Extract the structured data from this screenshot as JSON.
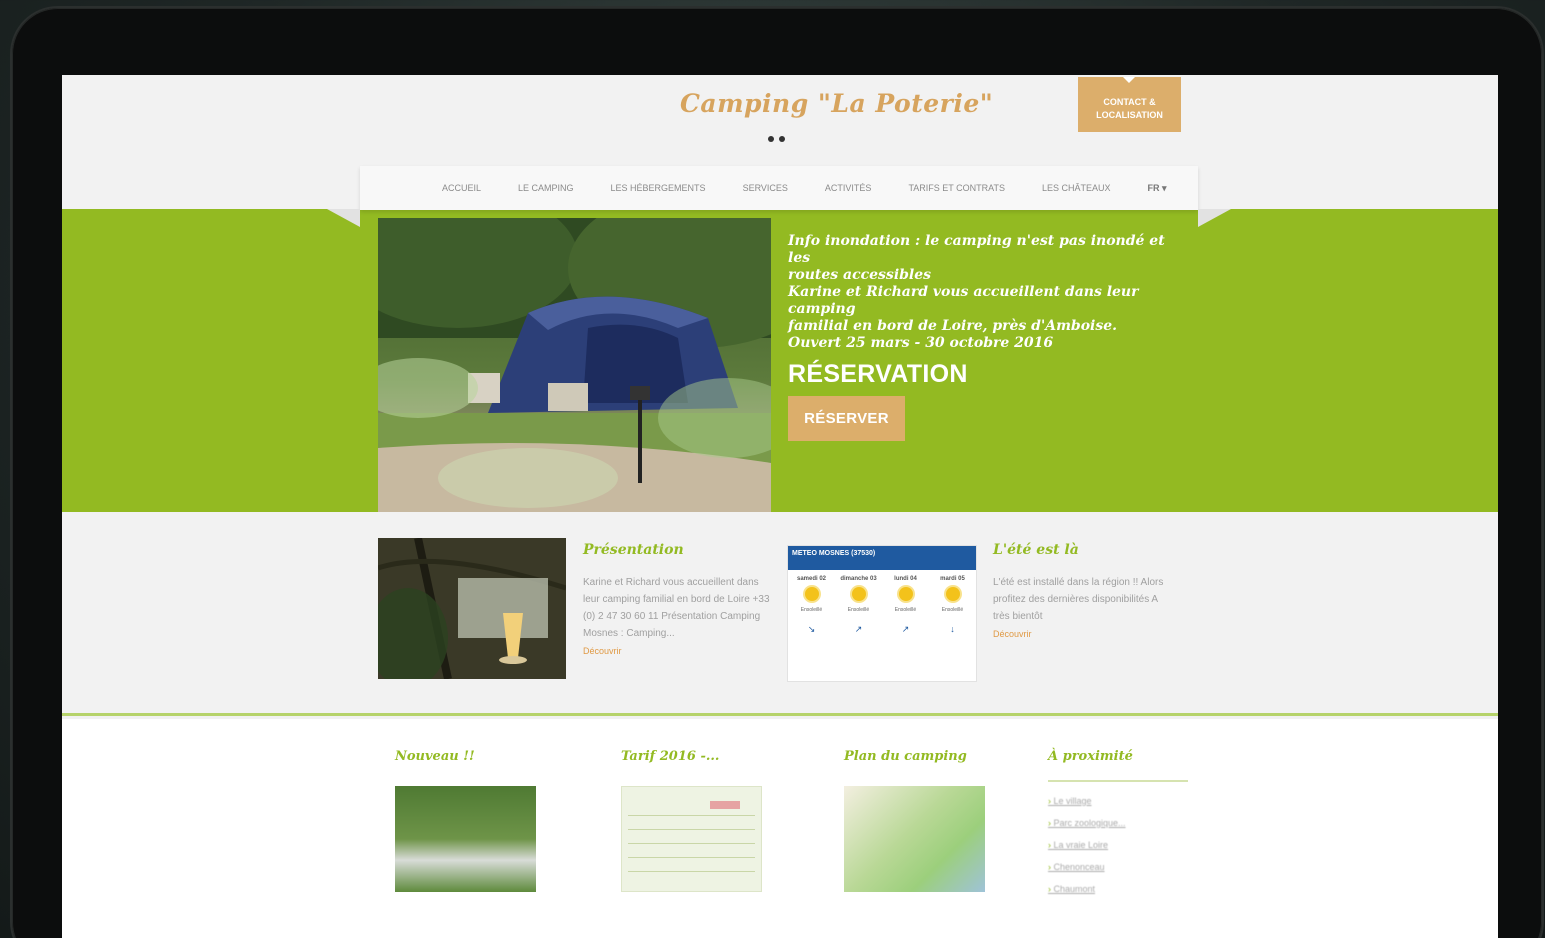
{
  "site": {
    "logo": "Camping \"La Poterie\"",
    "contact_button": "CONTACT & LOCALISATION"
  },
  "nav": {
    "items": [
      "ACCUEIL",
      "LE CAMPING",
      "LES HÉBERGEMENTS",
      "SERVICES",
      "ACTIVITÉS",
      "TARIFS ET CONTRATS",
      "LES CHÂTEAUX"
    ],
    "lang": "FR ▾"
  },
  "hero": {
    "info_lines": [
      "Info inondation : le camping n'est pas inondé et les",
      "routes accessibles",
      "Karine et Richard vous accueillent dans leur camping",
      "familial en bord de Loire, près d'Amboise.",
      "Ouvert 25 mars - 30 octobre 2016"
    ],
    "title": "RÉSERVATION",
    "button": "RÉSERVER"
  },
  "presentation": {
    "title": "Présentation",
    "text": "Karine et Richard vous accueillent dans leur camping familial en bord de Loire +33 (0) 2 47 30 60 11 Présentation Camping Mosnes : Camping...",
    "link": "Découvrir"
  },
  "weather": {
    "header": "METEO MOSNES (37530)",
    "days": [
      {
        "day": "samedi 02",
        "cond": "Ensoleillé"
      },
      {
        "day": "dimanche 03",
        "cond": "Ensoleillé"
      },
      {
        "day": "lundi 04",
        "cond": "Ensoleillé"
      },
      {
        "day": "mardi 05",
        "cond": "Ensoleillé"
      }
    ]
  },
  "ete": {
    "title": "L'été est là",
    "text": "L'été est installé dans la région !! Alors profitez des dernières disponibilités A très bientôt",
    "link": "Découvrir"
  },
  "bottom": {
    "nouveau_title": "Nouveau !!",
    "tarif_title": "Tarif 2016 -...",
    "plan_title": "Plan du camping",
    "proximite_title": "À proximité",
    "proximite_items": [
      "Le village",
      "Parc zoologique...",
      "La vraie Loire",
      "Chenonceau",
      "Chaumont"
    ]
  }
}
